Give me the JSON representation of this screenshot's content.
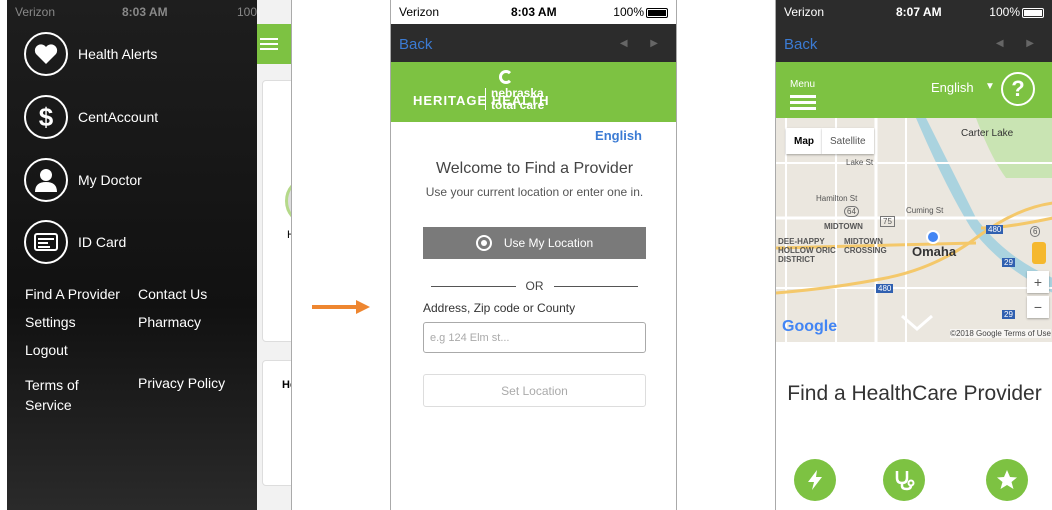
{
  "status": {
    "carrier": "Verizon",
    "time_p1": "8:03 AM",
    "time_p2": "8:03 AM",
    "time_p3": "8:07 AM",
    "battery_p1": "100",
    "battery_p2": "100%",
    "battery_p3": "100%"
  },
  "menu": {
    "icon_items": [
      {
        "label": "Health Alerts",
        "icon": "heart-icon"
      },
      {
        "label": "CentAccount",
        "icon": "dollar-icon"
      },
      {
        "label": "My Doctor",
        "icon": "doctor-icon"
      },
      {
        "label": "ID Card",
        "icon": "id-card-icon"
      }
    ],
    "links": {
      "find_provider": "Find A Provider",
      "contact_us": "Contact Us",
      "settings": "Settings",
      "pharmacy": "Pharmacy",
      "logout": "Logout",
      "terms": "Terms of Service",
      "privacy": "Privacy Policy"
    },
    "behind": {
      "card_h": "H",
      "card_he": "He"
    }
  },
  "provider_search": {
    "back": "Back",
    "logo_heritage": "HERITAGE HEALTH",
    "logo_ntc_line1": "nebraska",
    "logo_ntc_line2": "total care",
    "language": "English",
    "welcome": "Welcome to Find a Provider",
    "instructions": "Use your current location or enter one in.",
    "use_location": "Use My Location",
    "or": "OR",
    "address_label": "Address, Zip code or County",
    "address_placeholder": "e.g 124 Elm st...",
    "set_location": "Set Location"
  },
  "map_screen": {
    "back": "Back",
    "menu_label": "Menu",
    "language": "English",
    "help": "?",
    "map_tab": "Map",
    "satellite_tab": "Satellite",
    "city": "Omaha",
    "labels": {
      "carter_lake": "Carter Lake",
      "lake_st": "Lake St",
      "hamilton": "Hamilton St",
      "cuming": "Cuming St",
      "midtown": "MIDTOWN",
      "midtown_crossing": "MIDTOWN CROSSING",
      "deer_happy": "DEE-HAPPY HOLLOW ORIC DISTRICT",
      "hw64": "64",
      "hw75": "75",
      "hw480": "480",
      "hw29": "29",
      "hw6": "6"
    },
    "google": "Google",
    "credit": "©2018 Google  Terms of Use",
    "title": "Find a HealthCare Provider",
    "actions": [
      "lightning-icon",
      "stethoscope-icon",
      "star-icon"
    ]
  },
  "colors": {
    "brand_green": "#7dc242",
    "link_blue": "#3b7bd4",
    "arrow_orange": "#ee8630"
  }
}
